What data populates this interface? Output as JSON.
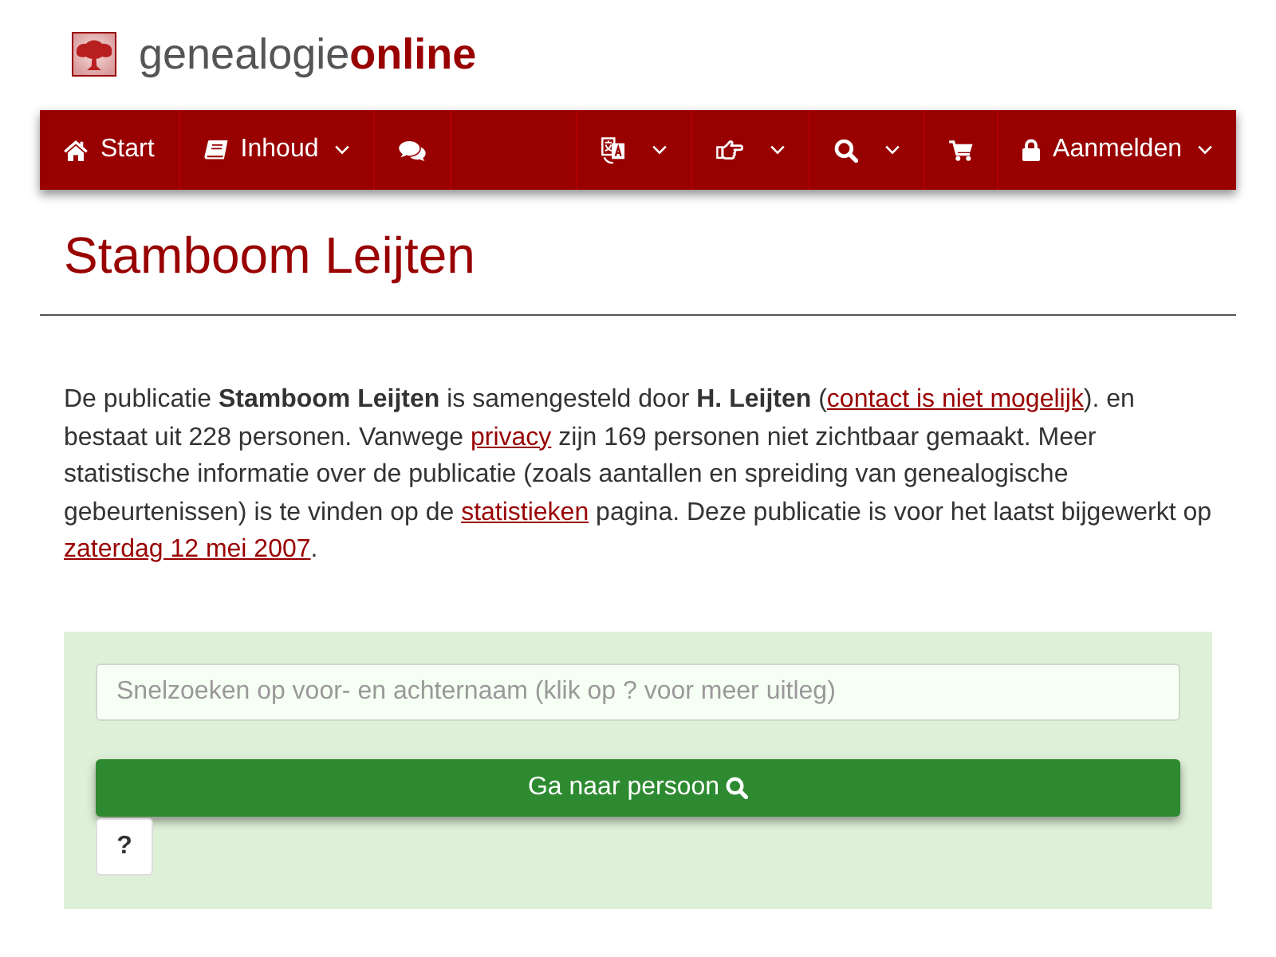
{
  "logo": {
    "wordmark": "genealogie**online**"
  },
  "nav": {
    "left": [
      {
        "label": "Start",
        "dropdown": false
      },
      {
        "label": "Inhoud",
        "dropdown": true
      },
      {
        "dropdown": false
      }
    ],
    "right": [
      {
        "dropdown": true
      },
      {
        "dropdown": true
      },
      {
        "dropdown": true
      },
      {
        "dropdown": false
      },
      {
        "label": "Aanmelden",
        "dropdown": true
      }
    ]
  },
  "page_title": "Stamboom Leijten",
  "intro": [
    {
      "kind": "text",
      "text": "De publicatie **Stamboom Leijten** is samengesteld door **H. Leijten** ("
    },
    {
      "kind": "link",
      "text": "contact is niet mogelijk"
    },
    {
      "kind": "text",
      "text": "). en bestaat uit 228 personen. Vanwege "
    },
    {
      "kind": "link",
      "text": "privacy"
    },
    {
      "kind": "text",
      "text": " zijn 169 personen niet zichtbaar gemaakt. Meer statistische informatie over de publicatie (zoals aantallen en spreiding van genealogische gebeurtenissen) is te vinden op de "
    },
    {
      "kind": "link",
      "text": "statistieken"
    },
    {
      "kind": "text",
      "text": " pagina. Deze publicatie is voor het laatst bijgewerkt op "
    },
    {
      "kind": "link",
      "text": "zaterdag 12 mei 2007"
    },
    {
      "kind": "text",
      "text": "."
    }
  ],
  "quick_search": {
    "placeholder": "Snelzoeken op voor- en achternaam (klik op ? voor meer uitleg)",
    "submit_label": "Ga naar persoon",
    "help_label": "?"
  }
}
